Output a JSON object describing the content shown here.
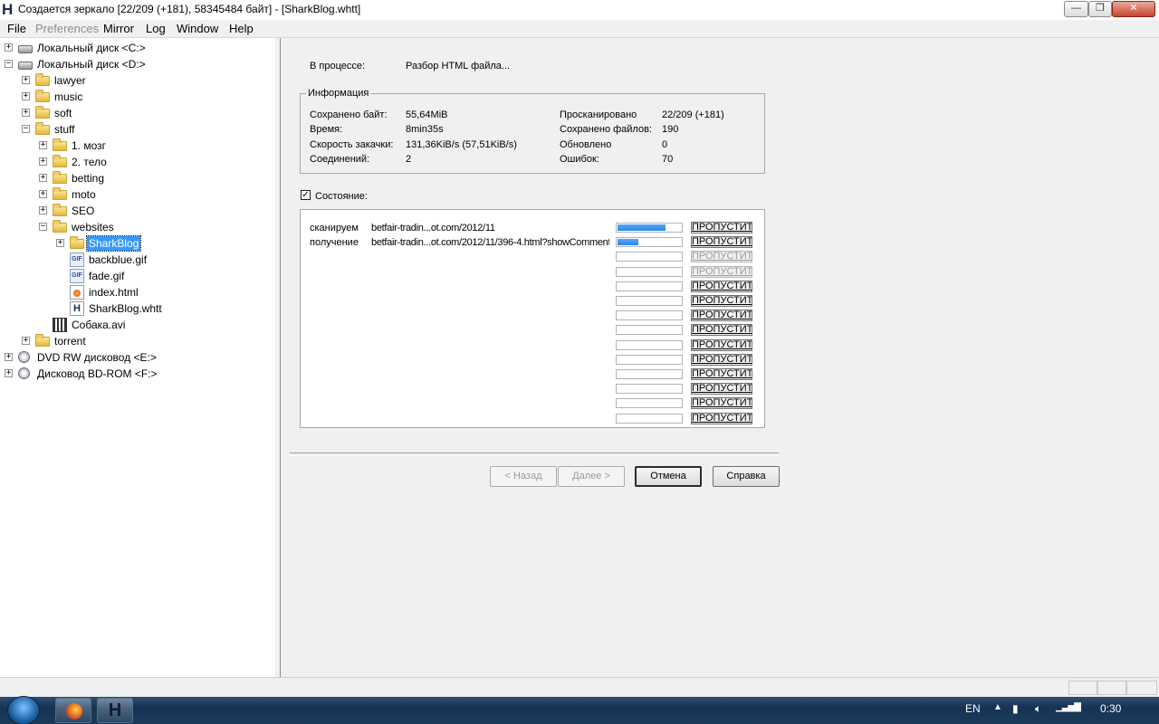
{
  "window": {
    "title": "Создается зеркало [22/209 (+181), 58345484 байт] - [SharkBlog.whtt]",
    "app_icon_letter": "H",
    "controls": {
      "minimize": "—",
      "maximize": "❐",
      "close": "✕"
    }
  },
  "menu": [
    "File",
    "Preferences",
    "Mirror",
    "Log",
    "Window",
    "Help"
  ],
  "tree": {
    "items": [
      {
        "label": "Локальный диск <C:>",
        "icon": "hard-drive-icon",
        "expander": "+"
      },
      {
        "label": "Локальный диск <D:>",
        "icon": "hard-drive-icon",
        "expander": "−"
      },
      {
        "label": "lawyer",
        "icon": "folder-icon",
        "expander": "+"
      },
      {
        "label": "music",
        "icon": "folder-icon",
        "expander": "+"
      },
      {
        "label": "soft",
        "icon": "folder-icon",
        "expander": "+"
      },
      {
        "label": "stuff",
        "icon": "folder-icon",
        "expander": "−"
      },
      {
        "label": "1. мозг",
        "icon": "folder-icon",
        "expander": "+"
      },
      {
        "label": "2. тело",
        "icon": "folder-icon",
        "expander": "+"
      },
      {
        "label": "betting",
        "icon": "folder-icon",
        "expander": "+"
      },
      {
        "label": "moto",
        "icon": "folder-icon",
        "expander": "+"
      },
      {
        "label": "SEO",
        "icon": "folder-icon",
        "expander": "+"
      },
      {
        "label": "websites",
        "icon": "folder-icon",
        "expander": "−"
      },
      {
        "label": "SharkBlog",
        "icon": "folder-icon",
        "expander": "+",
        "selected": true
      },
      {
        "label": "backblue.gif",
        "icon": "gif-file-icon"
      },
      {
        "label": "fade.gif",
        "icon": "gif-file-icon"
      },
      {
        "label": "index.html",
        "icon": "html-file-icon"
      },
      {
        "label": "SharkBlog.whtt",
        "icon": "whtt-file-icon"
      },
      {
        "label": "Собака.avi",
        "icon": "video-file-icon"
      },
      {
        "label": "torrent",
        "icon": "folder-icon",
        "expander": "+"
      },
      {
        "label": "DVD RW дисковод <E:>",
        "icon": "dvd-drive-icon",
        "expander": "+"
      },
      {
        "label": "Дисковод BD-ROM <F:>",
        "icon": "bd-drive-icon",
        "expander": "+"
      }
    ]
  },
  "progress": {
    "in_process_label": "В процессе:",
    "in_process_value": "Разбор HTML файла...",
    "info_group_title": "Информация",
    "left_stats": [
      {
        "label": "Сохранено байт:",
        "value": "55,64MiB"
      },
      {
        "label": "Время:",
        "value": "8min35s"
      },
      {
        "label": "Скорость закачки:",
        "value": "131,36KiB/s (57,51KiB/s)"
      },
      {
        "label": "Соединений:",
        "value": "2"
      }
    ],
    "right_stats": [
      {
        "label": "Просканировано",
        "value": "22/209 (+181)"
      },
      {
        "label": "Сохранено файлов:",
        "value": "190"
      },
      {
        "label": "Обновлено",
        "value": "0"
      },
      {
        "label": "Ошибок:",
        "value": "70"
      }
    ],
    "state_checkbox_label": "Состояние:",
    "state_checked": true,
    "transfers": [
      {
        "action": "сканируем",
        "url": "betfair-tradin...ot.com/2012/11",
        "progress": 0.75,
        "skip_label": "ПРОПУСТИТЬ",
        "enabled": true
      },
      {
        "action": "получение",
        "url": "betfair-tradin...ot.com/2012/11/396-4.html?showComment",
        "progress": 0.33,
        "skip_label": "ПРОПУСТИТЬ",
        "enabled": true
      },
      {
        "action": "",
        "url": "",
        "progress": 0,
        "skip_label": "ПРОПУСТИТЬ",
        "enabled": false
      },
      {
        "action": "",
        "url": "",
        "progress": 0,
        "skip_label": "ПРОПУСТИТЬ",
        "enabled": false
      },
      {
        "action": "",
        "url": "",
        "progress": 0,
        "skip_label": "ПРОПУСТИТЬ",
        "enabled": true
      },
      {
        "action": "",
        "url": "",
        "progress": 0,
        "skip_label": "ПРОПУСТИТЬ",
        "enabled": true
      },
      {
        "action": "",
        "url": "",
        "progress": 0,
        "skip_label": "ПРОПУСТИТЬ",
        "enabled": true
      },
      {
        "action": "",
        "url": "",
        "progress": 0,
        "skip_label": "ПРОПУСТИТЬ",
        "enabled": true
      },
      {
        "action": "",
        "url": "",
        "progress": 0,
        "skip_label": "ПРОПУСТИТЬ",
        "enabled": true
      },
      {
        "action": "",
        "url": "",
        "progress": 0,
        "skip_label": "ПРОПУСТИТЬ",
        "enabled": true
      },
      {
        "action": "",
        "url": "",
        "progress": 0,
        "skip_label": "ПРОПУСТИТЬ",
        "enabled": true
      },
      {
        "action": "",
        "url": "",
        "progress": 0,
        "skip_label": "ПРОПУСТИТЬ",
        "enabled": true
      },
      {
        "action": "",
        "url": "",
        "progress": 0,
        "skip_label": "ПРОПУСТИТЬ",
        "enabled": true
      },
      {
        "action": "",
        "url": "",
        "progress": 0,
        "skip_label": "ПРОПУСТИТЬ",
        "enabled": true
      }
    ],
    "buttons": {
      "back": "< Назад",
      "next": "Далее >",
      "cancel": "Отмена",
      "help": "Справка"
    }
  },
  "taskbar": {
    "language": "EN",
    "clock": "0:30",
    "tasks": [
      "firefox-icon",
      "httrack-icon"
    ]
  },
  "colors": {
    "progress_fill": "#2c85e8",
    "selection": "#3399ff",
    "taskbar": "#163355"
  }
}
